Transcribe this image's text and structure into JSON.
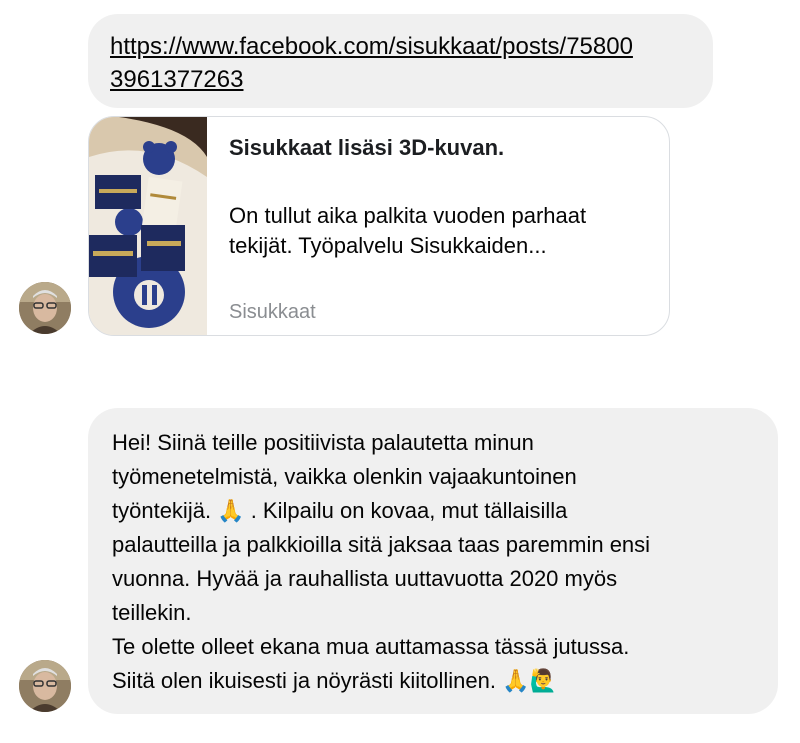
{
  "link_message": {
    "url": "https://www.facebook.com/sisukkaat/posts/758003961377263",
    "url_line1": "https://www.facebook.com/sisukkaat/posts/75800",
    "url_line2": "3961377263"
  },
  "link_preview": {
    "title": "Sisukkaat lisäsi 3D-kuvan.",
    "description_line1": "On tullut aika palkita vuoden parhaat",
    "description_line2": "tekijät. Työpalvelu Sisukkaiden...",
    "source": "Sisukkaat"
  },
  "message": {
    "paragraph1_lines": [
      "Hei! Siinä teille positiivista palautetta minun",
      "työmenetelmistä, vaikka olenkin vajaakuntoinen",
      "työntekijä. ",
      " . Kilpailu on kovaa, mut tällaisilla",
      "palautteilla ja palkkioilla sitä jaksaa taas paremmin ensi",
      "vuonna. Hyvää ja rauhallista uuttavuotta 2020 myös",
      "teillekin."
    ],
    "paragraph2_line1": "Te olette olleet ekana mua auttamassa tässä jutussa.",
    "paragraph2_line2": "Siitä olen ikuisesti ja nöyrästi kiitollinen. ",
    "emoji_pray": "🙏",
    "emoji_raise_hand": "🙋‍♂️"
  },
  "icons": {
    "avatar": "user-avatar-photo",
    "thumbnail": "preview-thumbnail-image"
  }
}
